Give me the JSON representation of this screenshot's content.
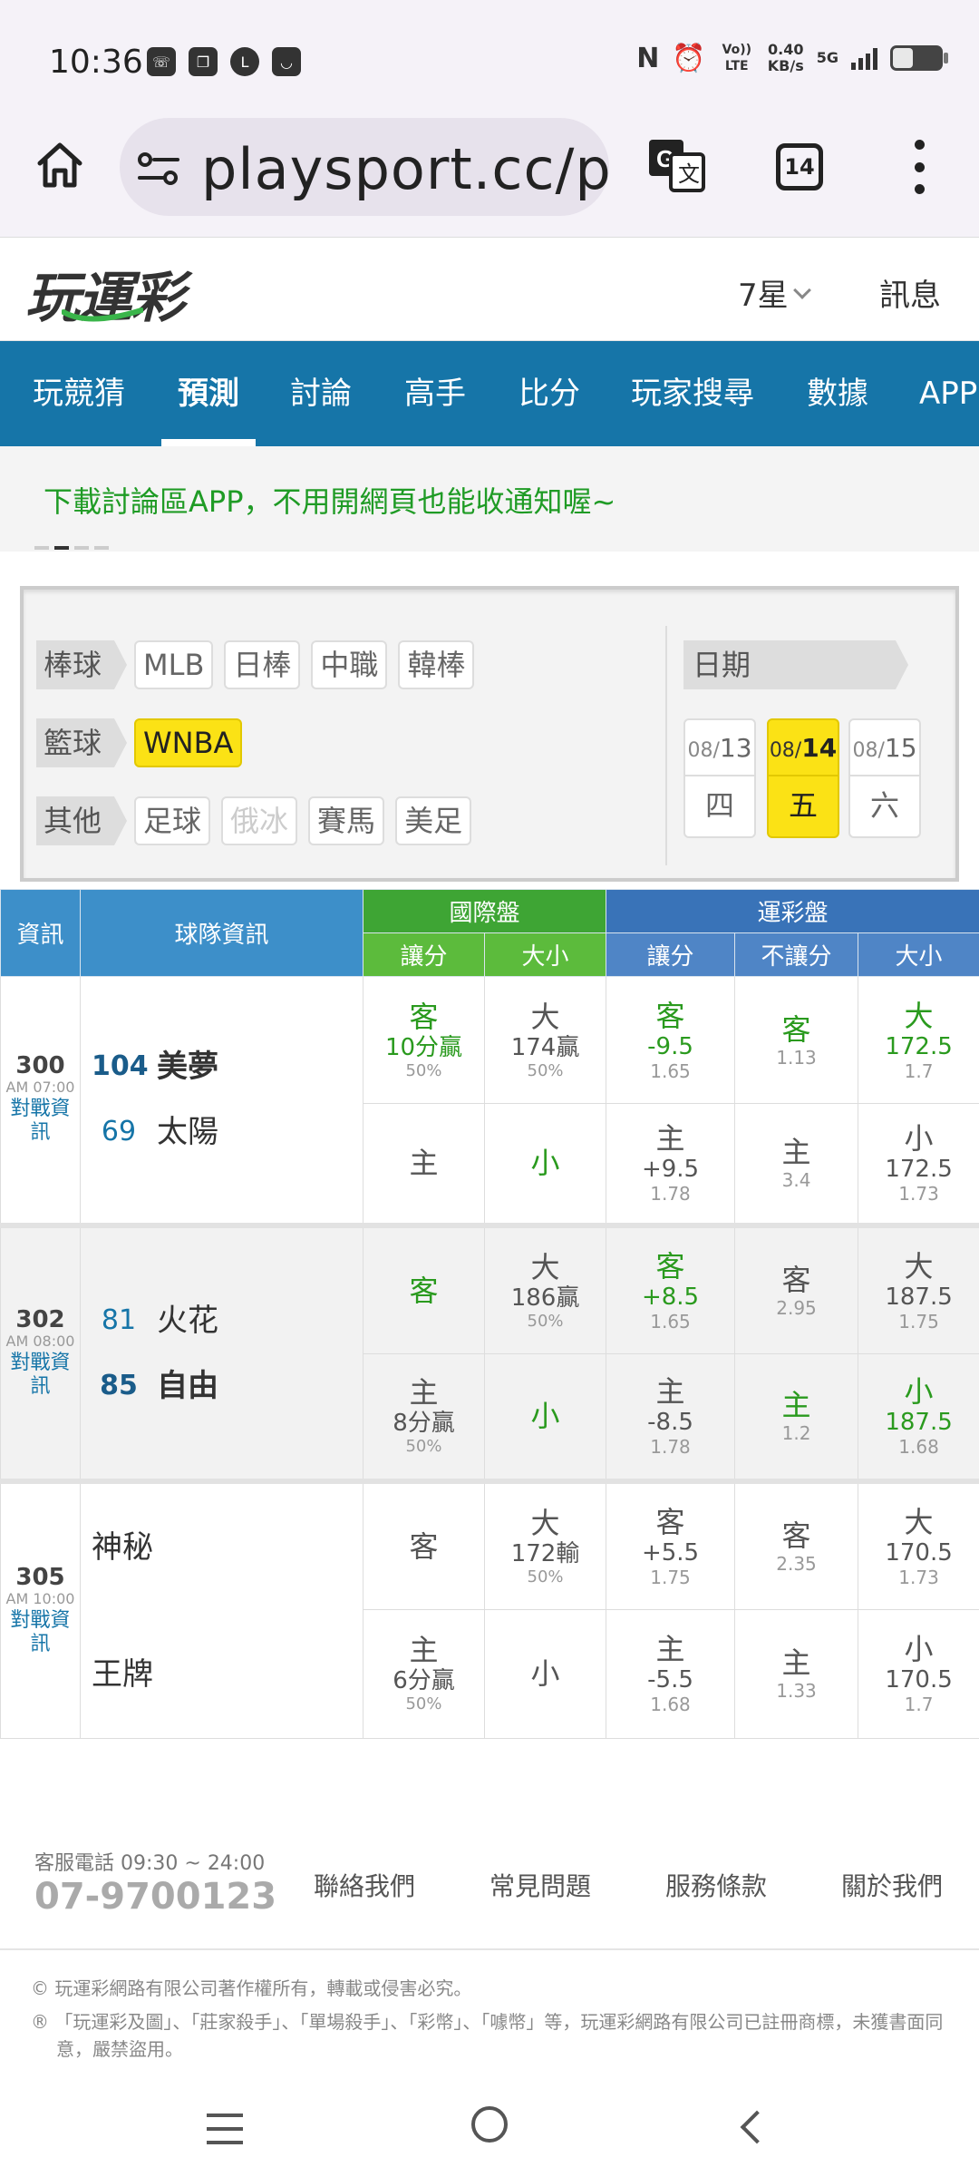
{
  "status": {
    "time": "10:36",
    "net_speed": "0.40",
    "net_unit": "KB/s",
    "net_type": "5G",
    "volte": "Vo)) LTE"
  },
  "browser": {
    "url": "playsport.cc/p",
    "tab_count": "14"
  },
  "header": {
    "logo": "玩運彩",
    "lottery": "7星",
    "messages": "訊息"
  },
  "nav": [
    {
      "label": "玩競猜",
      "active": false
    },
    {
      "label": "預測",
      "active": true
    },
    {
      "label": "討論",
      "active": false
    },
    {
      "label": "高手",
      "active": false
    },
    {
      "label": "比分",
      "active": false
    },
    {
      "label": "玩家搜尋",
      "active": false
    },
    {
      "label": "數據",
      "active": false
    },
    {
      "label": "APP",
      "active": false
    }
  ],
  "banner": {
    "text": "下載討論區APP，不用開網頁也能收通知喔~"
  },
  "filter": {
    "baseball_label": "棒球",
    "baseball": [
      "MLB",
      "日棒",
      "中職",
      "韓棒"
    ],
    "basketball_label": "籃球",
    "basketball": [
      "WNBA"
    ],
    "other_label": "其他",
    "other": [
      "足球",
      "俄冰",
      "賽馬",
      "美足"
    ],
    "date_label": "日期",
    "dates": [
      {
        "month": "08/",
        "day": "13",
        "weekday": "四"
      },
      {
        "month": "08/",
        "day": "14",
        "weekday": "五"
      },
      {
        "month": "08/",
        "day": "15",
        "weekday": "六"
      }
    ]
  },
  "table": {
    "headers": {
      "info": "資訊",
      "team": "球隊資訊",
      "intl": "國際盤",
      "sports": "運彩盤",
      "spread": "讓分",
      "total": "大小",
      "moneyline": "不讓分"
    },
    "link_text": "對戰資訊",
    "games": [
      {
        "no": "300",
        "time": "AM 07:00",
        "away": {
          "score": "104",
          "name": "美夢"
        },
        "home": {
          "score": "69",
          "name": "太陽"
        },
        "intl_spread_away": {
          "pick": "客",
          "sub": "10分贏",
          "pct": "50%"
        },
        "intl_spread_home": {
          "pick": "主"
        },
        "intl_total_over": {
          "pick": "大",
          "sub": "174贏",
          "pct": "50%"
        },
        "intl_total_under": {
          "pick": "小"
        },
        "spread_away": {
          "pick": "客",
          "line": "-9.5",
          "odds": "1.65"
        },
        "spread_home": {
          "pick": "主",
          "line": "+9.5",
          "odds": "1.78"
        },
        "ml_away": {
          "pick": "客",
          "odds": "1.13"
        },
        "ml_home": {
          "pick": "主",
          "odds": "3.4"
        },
        "total_over": {
          "pick": "大",
          "line": "172.5",
          "odds": "1.7"
        },
        "total_under": {
          "pick": "小",
          "line": "172.5",
          "odds": "1.73"
        }
      },
      {
        "no": "302",
        "time": "AM 08:00",
        "away": {
          "score": "81",
          "name": "火花"
        },
        "home": {
          "score": "85",
          "name": "自由"
        },
        "intl_spread_away": {
          "pick": "客"
        },
        "intl_spread_home": {
          "pick": "主",
          "sub": "8分贏",
          "pct": "50%"
        },
        "intl_total_over": {
          "pick": "大",
          "sub": "186贏",
          "pct": "50%"
        },
        "intl_total_under": {
          "pick": "小"
        },
        "spread_away": {
          "pick": "客",
          "line": "+8.5",
          "odds": "1.65"
        },
        "spread_home": {
          "pick": "主",
          "line": "-8.5",
          "odds": "1.78"
        },
        "ml_away": {
          "pick": "客",
          "odds": "2.95"
        },
        "ml_home": {
          "pick": "主",
          "odds": "1.2"
        },
        "total_over": {
          "pick": "大",
          "line": "187.5",
          "odds": "1.75"
        },
        "total_under": {
          "pick": "小",
          "line": "187.5",
          "odds": "1.68"
        }
      },
      {
        "no": "305",
        "time": "AM 10:00",
        "away": {
          "score": "",
          "name": "神秘"
        },
        "home": {
          "score": "",
          "name": "王牌"
        },
        "intl_spread_away": {
          "pick": "客"
        },
        "intl_spread_home": {
          "pick": "主",
          "sub": "6分贏",
          "pct": "50%"
        },
        "intl_total_over": {
          "pick": "大",
          "sub": "172輸",
          "pct": "50%"
        },
        "intl_total_under": {
          "pick": "小"
        },
        "spread_away": {
          "pick": "客",
          "line": "+5.5",
          "odds": "1.75"
        },
        "spread_home": {
          "pick": "主",
          "line": "-5.5",
          "odds": "1.68"
        },
        "ml_away": {
          "pick": "客",
          "odds": "2.35"
        },
        "ml_home": {
          "pick": "主",
          "odds": "1.33"
        },
        "total_over": {
          "pick": "大",
          "line": "170.5",
          "odds": "1.73"
        },
        "total_under": {
          "pick": "小",
          "line": "170.5",
          "odds": "1.7"
        }
      }
    ]
  },
  "footer": {
    "cs_label": "客服電話 09:30 ~ 24:00",
    "cs_phone": "07-9700123",
    "links": [
      "聯絡我們",
      "常見問題",
      "服務條款",
      "關於我們"
    ],
    "copyright": "© 玩運彩網路有限公司著作權所有，轉載或侵害必究。",
    "trademark": "® 「玩運彩及圖」、「莊家殺手」、「單場殺手」、「彩幣」、「噱幣」等，玩運彩網路有限公司已註冊商標，未獲書面同意，嚴禁盜用。"
  },
  "colors": {
    "brand_blue": "#1675a8",
    "highlight_yellow": "#fbe215",
    "win_green": "#2a9a1e"
  }
}
